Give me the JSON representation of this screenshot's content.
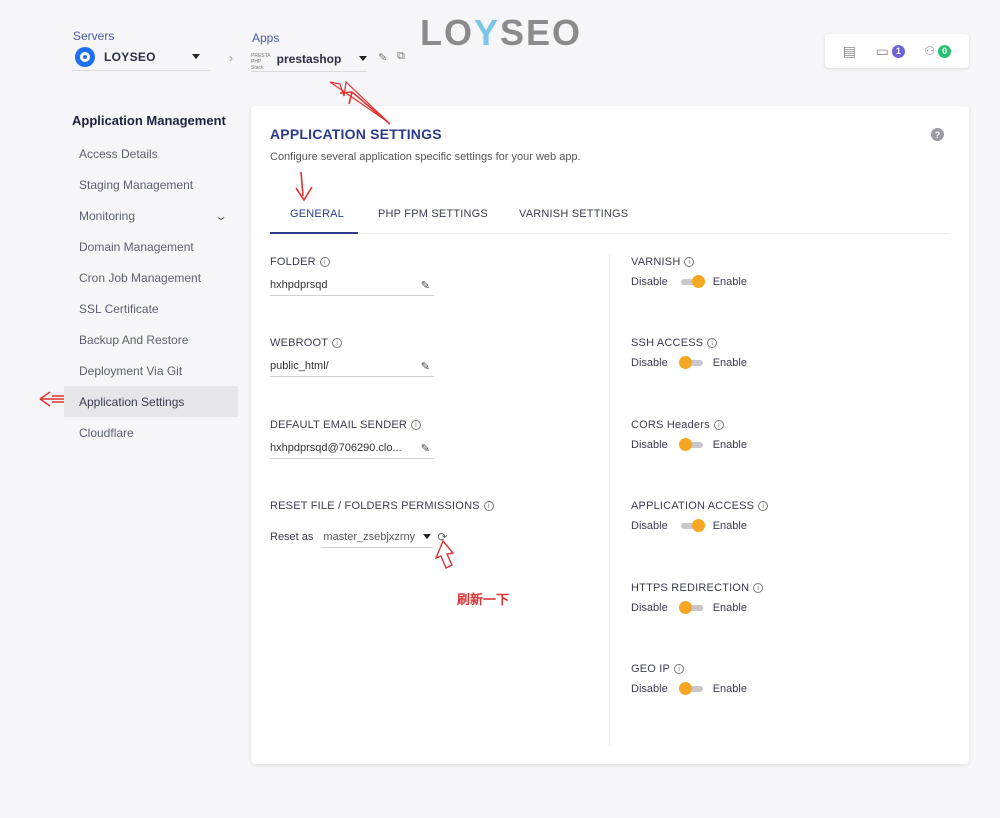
{
  "topbar": {
    "servers_label": "Servers",
    "server_name": "LOYSEO",
    "apps_label": "Apps",
    "app_name": "prestashop",
    "app_logo_text_1": "PRESTA",
    "app_logo_text_2": "PHP Stack",
    "brand_1": "LO",
    "brand_y": "Y",
    "brand_2": "SEO",
    "folder_badge": "1",
    "users_badge": "0",
    "folder_badge_color": "#6b63d6",
    "users_badge_color": "#29c275"
  },
  "sidebar": {
    "title": "Application Management",
    "items": [
      {
        "label": "Access Details"
      },
      {
        "label": "Staging Management"
      },
      {
        "label": "Monitoring"
      },
      {
        "label": "Domain Management"
      },
      {
        "label": "Cron Job Management"
      },
      {
        "label": "SSL Certificate"
      },
      {
        "label": "Backup And Restore"
      },
      {
        "label": "Deployment Via Git"
      },
      {
        "label": "Application Settings"
      },
      {
        "label": "Cloudflare"
      }
    ]
  },
  "panel": {
    "title": "APPLICATION SETTINGS",
    "subtitle": "Configure several application specific settings for your web app.",
    "help": "?",
    "tabs": [
      "GENERAL",
      "PHP FPM SETTINGS",
      "VARNISH SETTINGS"
    ],
    "fields": {
      "folder": {
        "label": "FOLDER",
        "value": "hxhpdprsqd"
      },
      "webroot": {
        "label": "WEBROOT",
        "value": "public_html/"
      },
      "email": {
        "label": "DEFAULT EMAIL SENDER",
        "value": "hxhpdprsqd@706290.clo..."
      },
      "reset": {
        "label": "RESET FILE / FOLDERS PERMISSIONS",
        "prefix": "Reset as",
        "selected": "master_zsebjxzrny"
      }
    },
    "toggles": [
      {
        "label": "VARNISH",
        "state": "on"
      },
      {
        "label": "SSH ACCESS",
        "state": "off"
      },
      {
        "label": "CORS Headers",
        "state": "off"
      },
      {
        "label": "APPLICATION ACCESS",
        "state": "on"
      },
      {
        "label": "HTTPS REDIRECTION",
        "state": "off"
      },
      {
        "label": "GEO IP",
        "state": "off"
      }
    ],
    "disable_label": "Disable",
    "enable_label": "Enable"
  },
  "annotation": {
    "text": "刷新一下",
    "color": "#d33333"
  },
  "colors": {
    "accent": "#2c3a8c",
    "toggle_knob": "#f5a623"
  }
}
